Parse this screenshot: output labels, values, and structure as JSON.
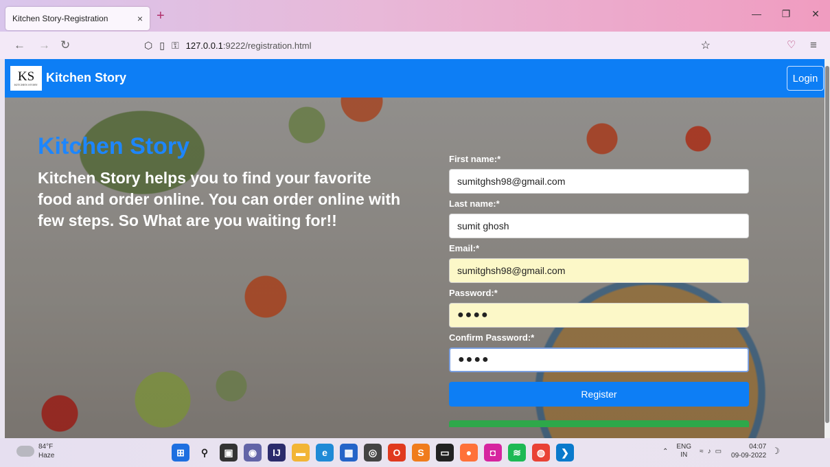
{
  "browser": {
    "tab_title": "Kitchen Story-Registration",
    "tab_close": "×",
    "new_tab": "+",
    "url_host": "127.0.0.1",
    "url_path": ":9222/registration.html"
  },
  "site": {
    "logo_text": "KS",
    "logo_subtext": "KITCHEN STORY",
    "brand": "Kitchen Story",
    "login_label": "Login"
  },
  "hero": {
    "title": "Kitchen Story",
    "text": "Kitchen Story helps you to find your favorite food and order online. You can order online with few steps. So What are you waiting for!!"
  },
  "form": {
    "first_name_label": "First name:*",
    "first_name_value": "sumitghsh98@gmail.com",
    "last_name_label": "Last name:*",
    "last_name_value": "sumit ghosh",
    "email_label": "Email:*",
    "email_value": "sumitghsh98@gmail.com",
    "password_label": "Password:*",
    "password_value": "●●●●",
    "confirm_label": "Confirm Password:*",
    "confirm_value": "●●●●",
    "register_label": "Register"
  },
  "taskbar": {
    "temperature": "84°F",
    "condition": "Haze",
    "lang_top": "ENG",
    "lang_bottom": "IN",
    "time": "04:07",
    "date": "09-09-2022"
  },
  "colors": {
    "site_blue": "#0d7ef5",
    "hero_title": "#1d86ff",
    "register_green": "#2ea84a",
    "autofill": "#fcf8c8"
  }
}
